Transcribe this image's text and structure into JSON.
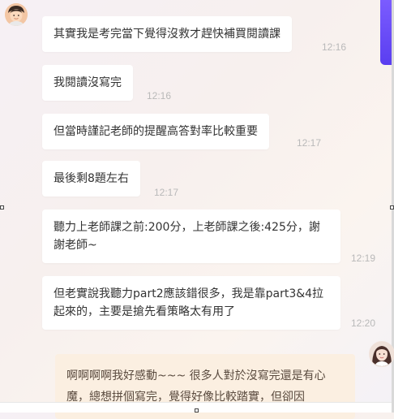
{
  "messages": [
    {
      "text": "其實我是考完當下覺得沒救才趕快補買閱讀課",
      "time": "12:16"
    },
    {
      "text": "我閱讀沒寫完",
      "time": "12:16"
    },
    {
      "text": "但當時謹記老師的提醒高答對率比較重要",
      "time": "12:17"
    },
    {
      "text": "最後剩8題左右",
      "time": "12:17"
    },
    {
      "text": "聽力上老師課之前:200分，上老師課之後:425分，謝謝老師~",
      "time": "12:19"
    },
    {
      "text": "但老實說我聽力part2應該錯很多，我是靠part3&4拉起來的，主要是搶先看策略太有用了",
      "time": "12:20"
    }
  ],
  "reply": {
    "text": "啊啊啊啊我好感動~~~ 很多人對於沒寫完還是有心魔，總想拼個寫完，覺得好像比較踏實，但卻因"
  },
  "colors": {
    "accent": "#6b4cf6",
    "reply_bg": "#fbefe1",
    "bubble_bg": "#ffffff",
    "time_text": "#b9b9b9"
  },
  "icons": {
    "user_avatar": "user-avatar-icon",
    "teacher_avatar": "teacher-avatar-icon"
  }
}
